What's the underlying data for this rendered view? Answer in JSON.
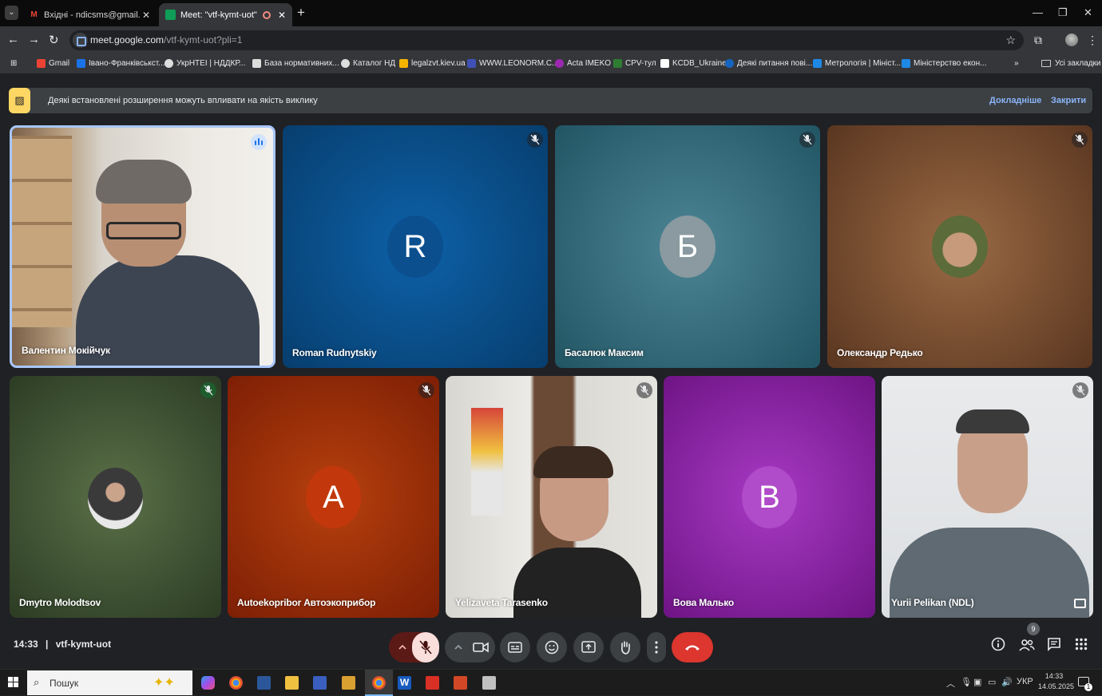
{
  "browser": {
    "tabs": [
      {
        "title": "Вхідні - ndicsms@gmail.com - ",
        "icon": "gmail-icon",
        "active": false
      },
      {
        "title": "Meet: \"vtf-kymt-uot\"",
        "icon": "meet-icon",
        "active": true
      }
    ],
    "url_host": "meet.google.com",
    "url_path": "/vtf-kymt-uot?pli=1",
    "bookmarks": [
      {
        "label": "Gmail",
        "color": "#ea4335"
      },
      {
        "label": "Івано-Франківськст...",
        "color": "#1a73e8"
      },
      {
        "label": "УкрНТЕІ | НДДКР...",
        "color": "#dddddd"
      },
      {
        "label": "База нормативних...",
        "color": "#dddddd"
      },
      {
        "label": "Каталог НД",
        "color": "#dddddd"
      },
      {
        "label": "legalzvt.kiev.ua",
        "color": "#f4b400"
      },
      {
        "label": "WWW.LEONORM.C...",
        "color": "#3f51b5"
      },
      {
        "label": "Acta IMEKO",
        "color": "#9c27b0"
      },
      {
        "label": "CPV-тул",
        "color": "#2e7d32"
      },
      {
        "label": "KCDB_Ukraine",
        "color": "#ffffff"
      },
      {
        "label": "Деякі питання пові...",
        "color": "#1565c0"
      },
      {
        "label": "Метрологія | Мініст...",
        "color": "#1e88e5"
      },
      {
        "label": "Міністерство екон...",
        "color": "#1e88e5"
      }
    ],
    "all_bookmarks": "Усі закладки"
  },
  "banner": {
    "text": "Деякі встановлені розширення можуть впливати на якість виклику",
    "learn_more": "Докладніше",
    "close": "Закрити"
  },
  "participants": [
    {
      "name": "Валентин Мокійчук",
      "state": "speaking",
      "kind": "video"
    },
    {
      "name": "Roman Rudnytskiy",
      "state": "muted",
      "kind": "letter",
      "letter": "R",
      "avatar_color": "#0b4f8f",
      "bg": "#0a4f88"
    },
    {
      "name": "Басалюк Максим",
      "state": "muted",
      "kind": "letter",
      "letter": "Б",
      "avatar_color": "#8a9aa0",
      "bg": "#2f6a7a"
    },
    {
      "name": "Олександр Редько",
      "state": "muted",
      "kind": "photo",
      "bg": "#7a4a2a"
    },
    {
      "name": "Dmytro Molodtsov",
      "state": "muted",
      "kind": "photo",
      "bg": "#3b5230"
    },
    {
      "name": "Autoekopribor Автоэкоприбор",
      "state": "muted",
      "kind": "letter",
      "letter": "A",
      "avatar_color": "#c2380c",
      "bg": "#a12a07"
    },
    {
      "name": "Yelizaveta Tarasenko",
      "state": "muted",
      "kind": "video"
    },
    {
      "name": "Вова Малько",
      "state": "muted",
      "kind": "letter",
      "letter": "В",
      "avatar_color": "#b04bc9",
      "bg": "#8a1d9e"
    },
    {
      "name": "Yurii Pelikan (NDL)",
      "state": "muted",
      "kind": "video"
    }
  ],
  "meeting": {
    "time": "14:33",
    "code": "vtf-kymt-uot",
    "participant_count": "9"
  },
  "taskbar": {
    "search_placeholder": "Пошук",
    "lang": "УКР",
    "time": "14:33",
    "date": "14.05.2025",
    "notifications": "1"
  }
}
